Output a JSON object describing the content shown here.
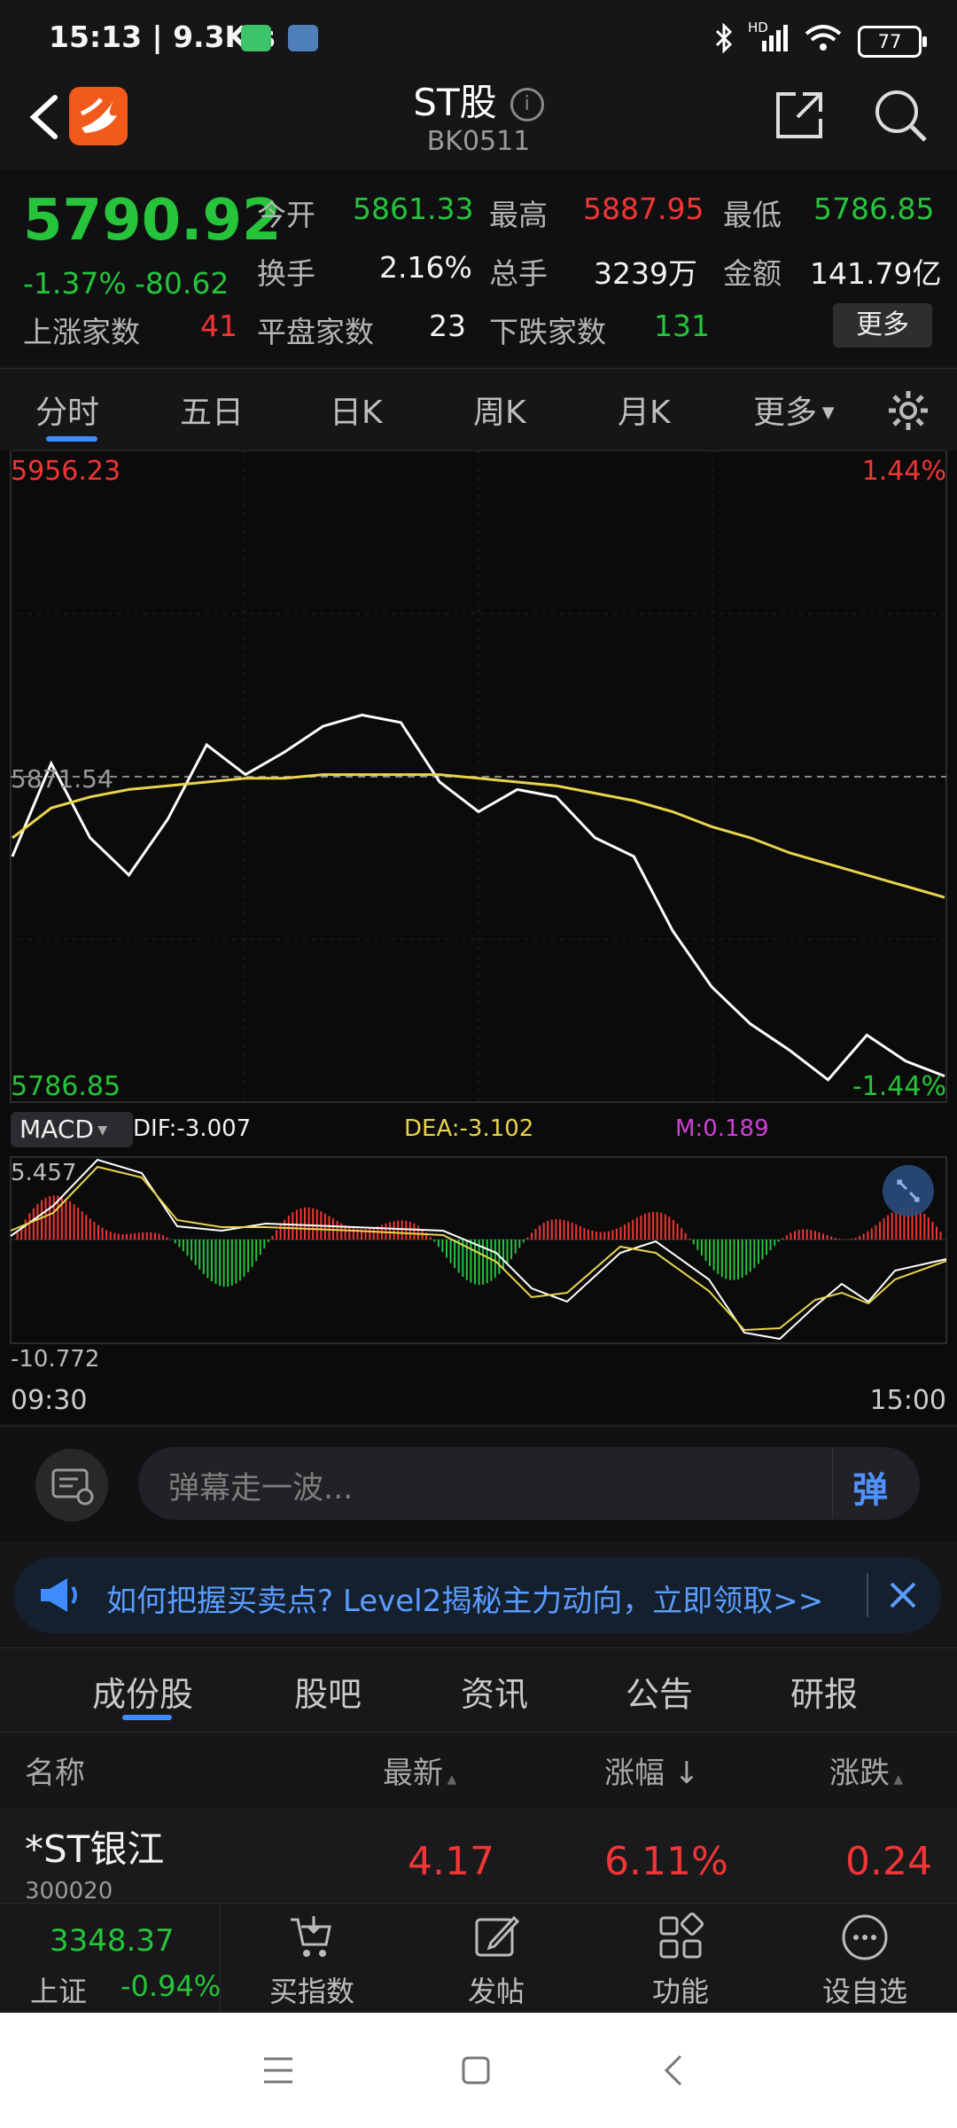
{
  "status_bar": {
    "time": "15:13 | 9.3K/s",
    "signal": "HD",
    "battery": "77"
  },
  "header": {
    "title": "ST股",
    "code": "BK0511"
  },
  "quote": {
    "price": "5790.92",
    "change_pct": "-1.37%",
    "change": "-80.62",
    "open_label": "今开",
    "open": "5861.33",
    "high_label": "最高",
    "high": "5887.95",
    "low_label": "最低",
    "low": "5786.85",
    "turnover_label": "换手",
    "turnover": "2.16%",
    "volume_label": "总手",
    "volume": "3239万",
    "amount_label": "金额",
    "amount": "141.79亿",
    "up_label": "上涨家数",
    "up": "41",
    "flat_label": "平盘家数",
    "flat": "23",
    "down_label": "下跌家数",
    "down": "131",
    "more_button": "更多"
  },
  "kline_tabs": [
    "分时",
    "五日",
    "日K",
    "周K",
    "月K",
    "更多"
  ],
  "chart": {
    "price_top": "5956.23",
    "pct_top": "1.44%",
    "mid_price": "5871.54",
    "price_bottom": "5786.85",
    "pct_bottom": "-1.44%",
    "macd_selector": "MACD",
    "dif": "DIF:-3.007",
    "dea": "DEA:-3.102",
    "m": "M:0.189",
    "macd_top": "5.457",
    "macd_bottom": "-10.772",
    "time_start": "09:30",
    "time_end": "15:00",
    "colors": {
      "price_line": "#ffffff",
      "avg_line": "#e8d44d",
      "up": "#f23535",
      "down": "#25c43a"
    }
  },
  "chart_data": {
    "type": "line",
    "ylim": [
      5786.85,
      5956.23
    ],
    "x": [
      "09:30",
      "15:00"
    ],
    "series": [
      {
        "values": [
          5850,
          5875,
          5855,
          5845,
          5860,
          5880,
          5872,
          5878,
          5885,
          5888,
          5886,
          5870,
          5862,
          5868,
          5866,
          5855,
          5850,
          5830,
          5815,
          5805,
          5798,
          5790,
          5802,
          5795,
          5791
        ]
      },
      {
        "values": [
          5855,
          5863,
          5866,
          5868,
          5869,
          5870,
          5871,
          5871,
          5872,
          5872,
          5872,
          5872,
          5871,
          5870,
          5869,
          5867,
          5865,
          5862,
          5858,
          5855,
          5851,
          5848,
          5845,
          5842,
          5839
        ]
      }
    ]
  },
  "danmaku": {
    "placeholder": "弹幕走一波...",
    "send": "弹"
  },
  "banner": {
    "text": "如何把握买卖点? Level2揭秘主力动向，立即领取>>"
  },
  "component_tabs": [
    "成份股",
    "股吧",
    "资讯",
    "公告",
    "研报"
  ],
  "table": {
    "headers": [
      "名称",
      "最新",
      "涨幅",
      "涨跌"
    ],
    "rows": [
      {
        "name": "*ST银江",
        "code": "300020",
        "last": "4.17",
        "pct": "6.11%",
        "chg": "0.24"
      }
    ]
  },
  "bottom_bar": {
    "index_value": "3348.37",
    "index_name": "上证",
    "index_pct": "-0.94%",
    "items": [
      "买指数",
      "发帖",
      "功能",
      "设自选"
    ]
  }
}
